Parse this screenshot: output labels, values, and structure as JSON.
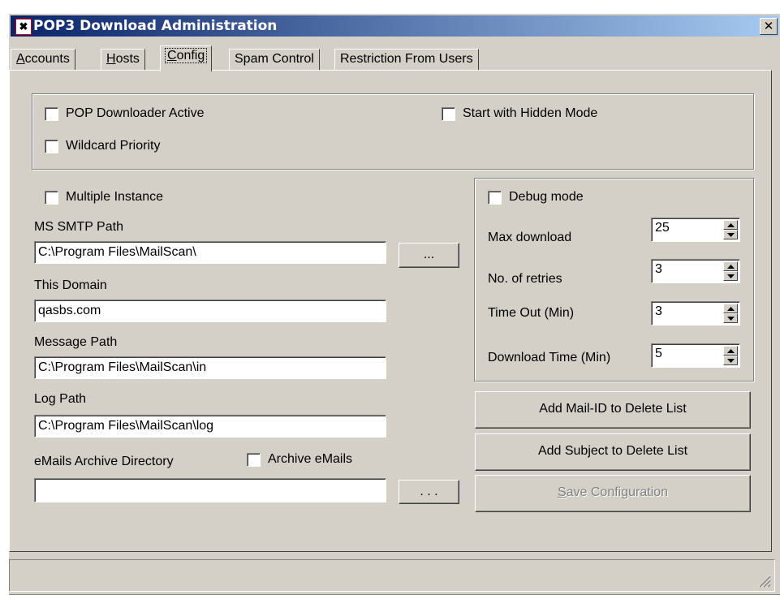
{
  "window": {
    "title": "POP3 Download Administration",
    "close_glyph": "✕"
  },
  "tabs": [
    {
      "label": "Accounts",
      "underline": "A",
      "rest": "ccounts"
    },
    {
      "label": "Hosts",
      "underline": "H",
      "rest": "osts"
    },
    {
      "label": "Config",
      "underline": "C",
      "rest": "onfig",
      "active": true
    },
    {
      "label": "Spam Control"
    },
    {
      "label": "Restriction From Users"
    }
  ],
  "top_group": {
    "pop_downloader_active": "POP Downloader Active",
    "start_hidden": "Start with Hidden Mode",
    "wildcard_priority": "Wildcard Priority"
  },
  "left": {
    "multiple_instance": "Multiple Instance",
    "ms_smtp_path_label": "MS SMTP Path",
    "ms_smtp_path_value": "C:\\Program Files\\MailScan\\",
    "browse_label": "...",
    "this_domain_label": "This Domain",
    "this_domain_value": "qasbs.com",
    "message_path_label": "Message Path",
    "message_path_value": "C:\\Program Files\\MailScan\\in",
    "log_path_label": "Log Path",
    "log_path_value": "C:\\Program Files\\MailScan\\log",
    "archive_dir_label": "eMails Archive Directory",
    "archive_emails": "Archive eMails",
    "archive_dir_value": "",
    "archive_browse_label": ". . ."
  },
  "right": {
    "debug_mode": "Debug mode",
    "max_download_label": "Max download",
    "max_download_value": "25",
    "retries_label": "No. of retries",
    "retries_value": "3",
    "timeout_label": "Time Out (Min)",
    "timeout_value": "3",
    "download_time_label": "Download Time (Min)",
    "download_time_value": "5"
  },
  "buttons": {
    "add_mail_id": "Add Mail-ID to Delete List",
    "add_subject": "Add Subject to Delete List",
    "save_config_underline": "S",
    "save_config_rest": "ave Configuration"
  }
}
